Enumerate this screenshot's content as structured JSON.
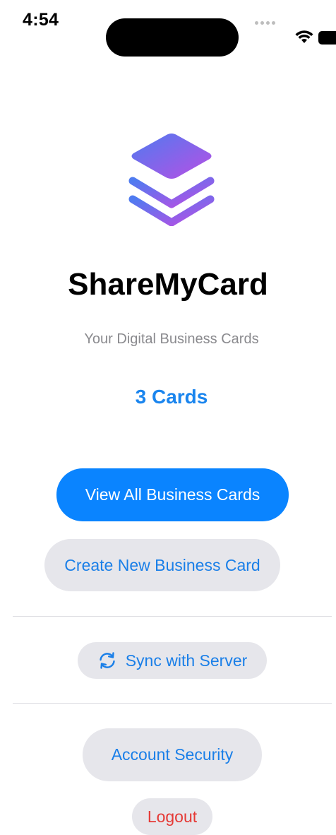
{
  "status_bar": {
    "time": "4:54"
  },
  "app": {
    "title": "ShareMyCard",
    "subtitle": "Your Digital Business Cards",
    "card_count": "3 Cards",
    "logo_icon": "stacked-layers-icon",
    "gradient_colors": [
      "#4f7bf0",
      "#b84fe4"
    ]
  },
  "actions": {
    "view_all": "View All Business Cards",
    "create_new": "Create New Business Card",
    "sync": "Sync with Server",
    "sync_icon": "sync-arrows-icon",
    "account_security": "Account Security",
    "logout": "Logout"
  },
  "colors": {
    "accent": "#0a84ff",
    "link": "#1a7fe8",
    "destructive": "#e53935",
    "secondary_bg": "#e6e6eb"
  }
}
